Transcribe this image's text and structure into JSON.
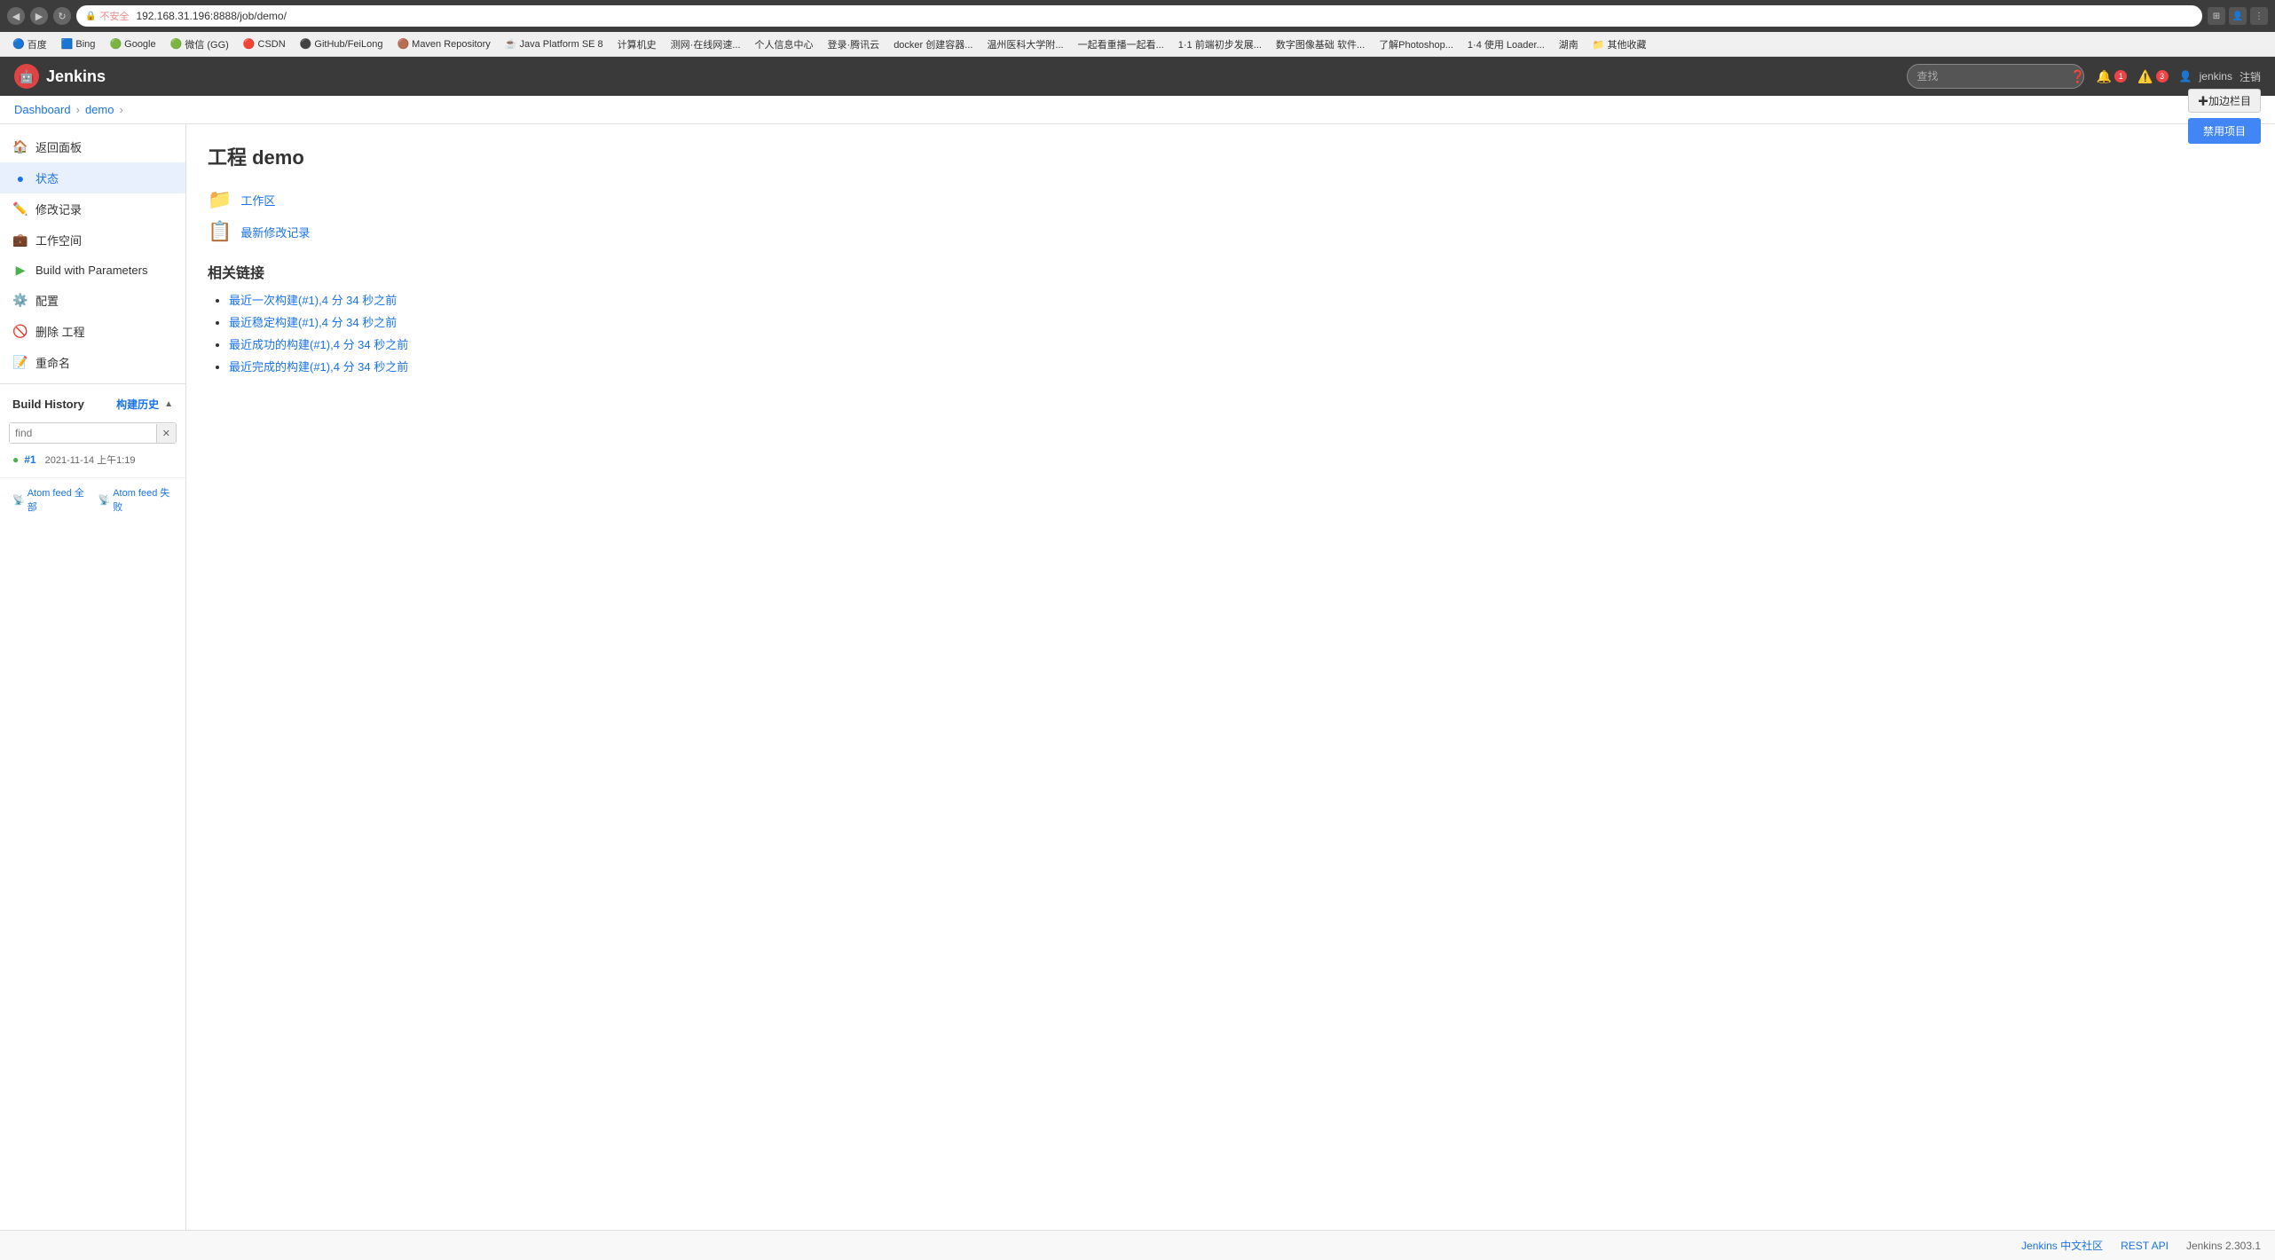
{
  "browser": {
    "url": "192.168.31.196:8888/job/demo/",
    "back_btn": "◀",
    "forward_btn": "▶",
    "refresh_btn": "↻",
    "lock_icon": "🔒",
    "security_label": "不安全"
  },
  "bookmarks": [
    {
      "label": "百度",
      "icon": "🔵"
    },
    {
      "label": "Bing",
      "icon": "🟦"
    },
    {
      "label": "Google",
      "icon": "🟢"
    },
    {
      "label": "微信 (GG)",
      "icon": "🟢"
    },
    {
      "label": "CSDN",
      "icon": "🔴"
    },
    {
      "label": "GitHub/FeiLong",
      "icon": "⚫"
    },
    {
      "label": "Maven Repository",
      "icon": "🟤"
    },
    {
      "label": "Java Platform SE 8",
      "icon": "☕"
    },
    {
      "label": "计算机史",
      "icon": "📘"
    },
    {
      "label": "测网·在线网速...",
      "icon": "🔵"
    },
    {
      "label": "个人信息中心",
      "icon": "👤"
    },
    {
      "label": "登录·腾讯云",
      "icon": "🔵"
    },
    {
      "label": "docker 创建容器...",
      "icon": "🐳"
    },
    {
      "label": "温州医科大学附...",
      "icon": "🔵"
    },
    {
      "label": "一起看重播一起看...",
      "icon": "🔵"
    },
    {
      "label": "1·1 前端初步发展...",
      "icon": "🔵"
    },
    {
      "label": "数字图像基础 软件...",
      "icon": "🔵"
    },
    {
      "label": "了解Photoshop...",
      "icon": "🔵"
    },
    {
      "label": "1·4 使用 Loader...",
      "icon": "🔵"
    },
    {
      "label": "湖南",
      "icon": "🔵"
    },
    {
      "label": "其他收藏",
      "icon": "📁"
    }
  ],
  "jenkins": {
    "logo_text": "Jenkins",
    "search_placeholder": "查找",
    "notification_count": "1",
    "error_count": "3",
    "user_label": "jenkins",
    "logout_label": "注销"
  },
  "breadcrumb": {
    "dashboard_label": "Dashboard",
    "separator": "›",
    "current_label": "demo",
    "separator2": "›"
  },
  "sidebar": {
    "items": [
      {
        "label": "返回面板",
        "icon": "🏠",
        "name": "back-to-dashboard"
      },
      {
        "label": "状态",
        "icon": "🔵",
        "name": "status",
        "active": true
      },
      {
        "label": "修改记录",
        "icon": "✏️",
        "name": "changes"
      },
      {
        "label": "工作空间",
        "icon": "💼",
        "name": "workspace"
      },
      {
        "label": "Build with Parameters",
        "icon": "▶",
        "name": "build-with-parameters"
      },
      {
        "label": "配置",
        "icon": "⚙️",
        "name": "configure"
      },
      {
        "label": "删除 工程",
        "icon": "🚫",
        "name": "delete-project"
      },
      {
        "label": "重命名",
        "icon": "📝",
        "name": "rename"
      }
    ],
    "build_history": {
      "title": "Build History",
      "history_link": "构建历史",
      "search_placeholder": "find",
      "builds": [
        {
          "number": "#1",
          "date": "2021-11-14 上午1:19",
          "status": "success"
        }
      ]
    },
    "atom_feeds": [
      {
        "label": "Atom feed 全部",
        "icon": "📡"
      },
      {
        "label": "Atom feed 失败",
        "icon": "📡"
      }
    ]
  },
  "content": {
    "page_title": "工程 demo",
    "links": [
      {
        "icon": "📁",
        "label": "工作区",
        "name": "workspace-link"
      },
      {
        "icon": "📋",
        "label": "最新修改记录",
        "name": "latest-changes-link"
      }
    ],
    "related_links_title": "相关链接",
    "related_links": [
      {
        "text": "最近一次构建(#1),4 分 34 秒之前",
        "name": "latest-build-link"
      },
      {
        "text": "最近稳定构建(#1),4 分 34 秒之前",
        "name": "stable-build-link"
      },
      {
        "text": "最近成功的构建(#1),4 分 34 秒之前",
        "name": "successful-build-link"
      },
      {
        "text": "最近完成的构建(#1),4 分 34 秒之前",
        "name": "completed-build-link"
      }
    ],
    "float_add_label": "✚加边栏目",
    "float_disable_label": "禁用项目"
  },
  "footer": {
    "community_label": "Jenkins 中文社区",
    "rest_api_label": "REST API",
    "version_label": "Jenkins 2.303.1"
  },
  "atom_feed": {
    "all_label": "Atom feed 全部",
    "fail_label": "Atom feed 失败"
  }
}
